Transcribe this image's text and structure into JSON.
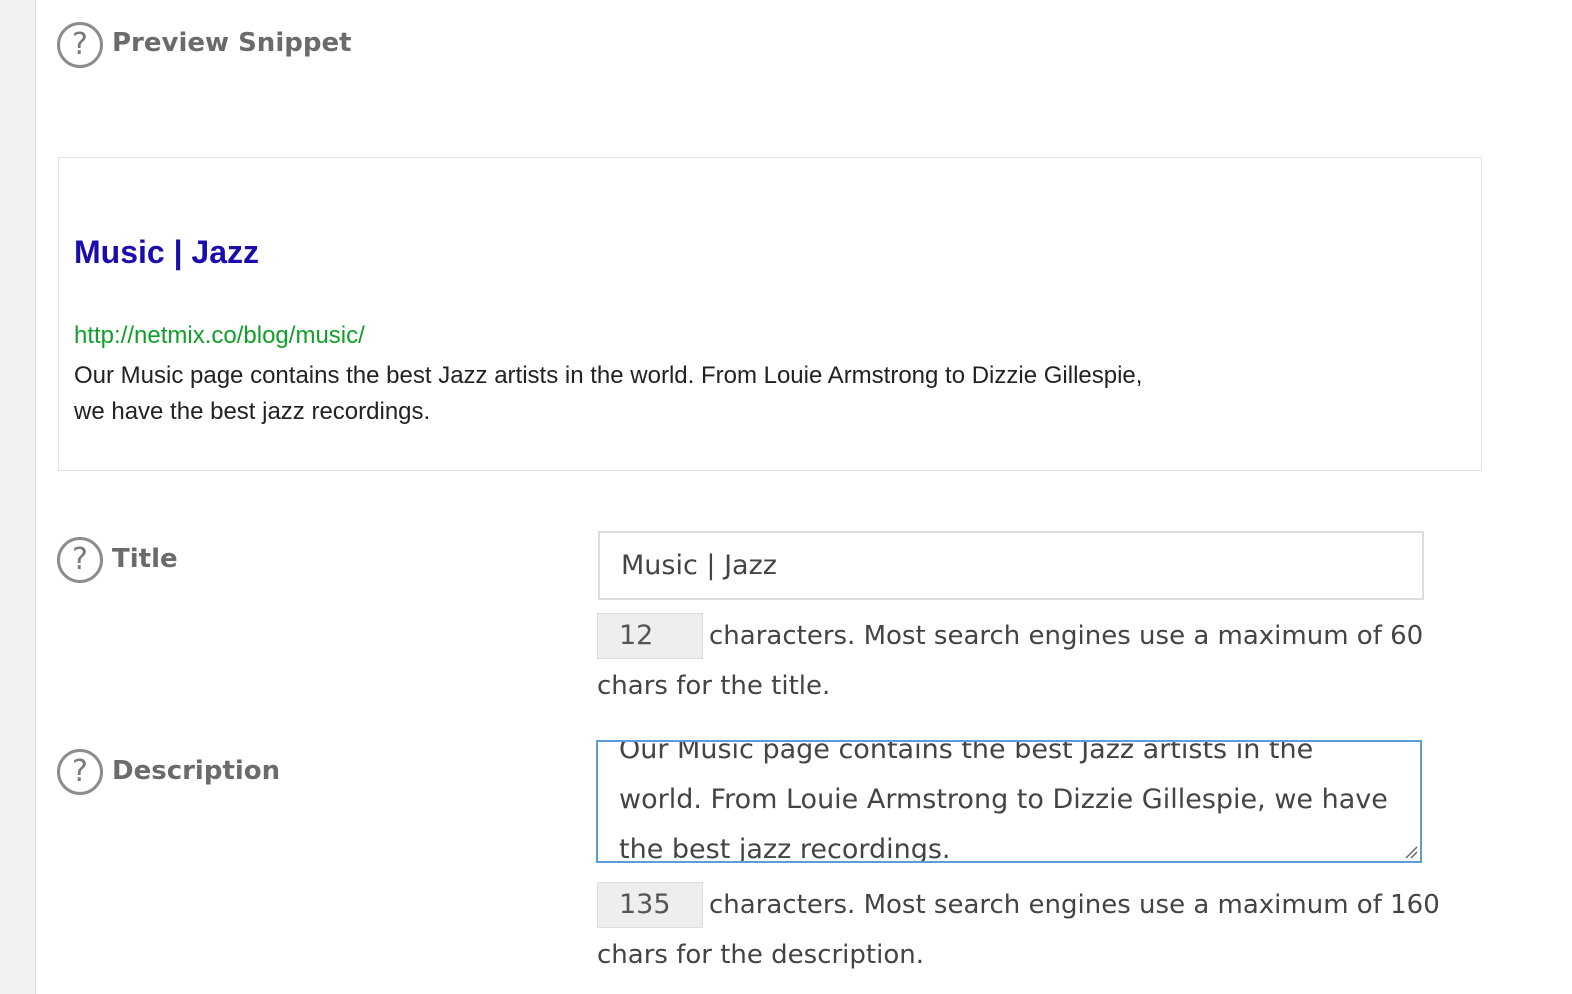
{
  "preview": {
    "label": "Preview Snippet",
    "snippet_title": "Music | Jazz",
    "snippet_url": "http://netmix.co/blog/music/",
    "snippet_description": "Our Music page contains the best Jazz artists in the world. From Louie Armstrong to Dizzie Gillespie, we have the best jazz recordings."
  },
  "help_icon_glyph": "?",
  "title_field": {
    "label": "Title",
    "value": "Music | Jazz",
    "char_count": "12",
    "help_text": "characters. Most search engines use a maximum of 60 chars for the title."
  },
  "description_field": {
    "label": "Description",
    "value": "Our Music page contains the best Jazz artists in the world. From Louie Armstrong to Dizzie Gillespie, we have the best jazz recordings.",
    "char_count": "135",
    "help_text": "characters. Most search engines use a maximum of 160 chars for the description."
  },
  "colors": {
    "snippet_title": "#1a0dab",
    "snippet_url": "#10a02a",
    "focus_border": "#5b9dd9"
  },
  "icons": [
    "help-circle-icon",
    "resize-grip-icon"
  ]
}
